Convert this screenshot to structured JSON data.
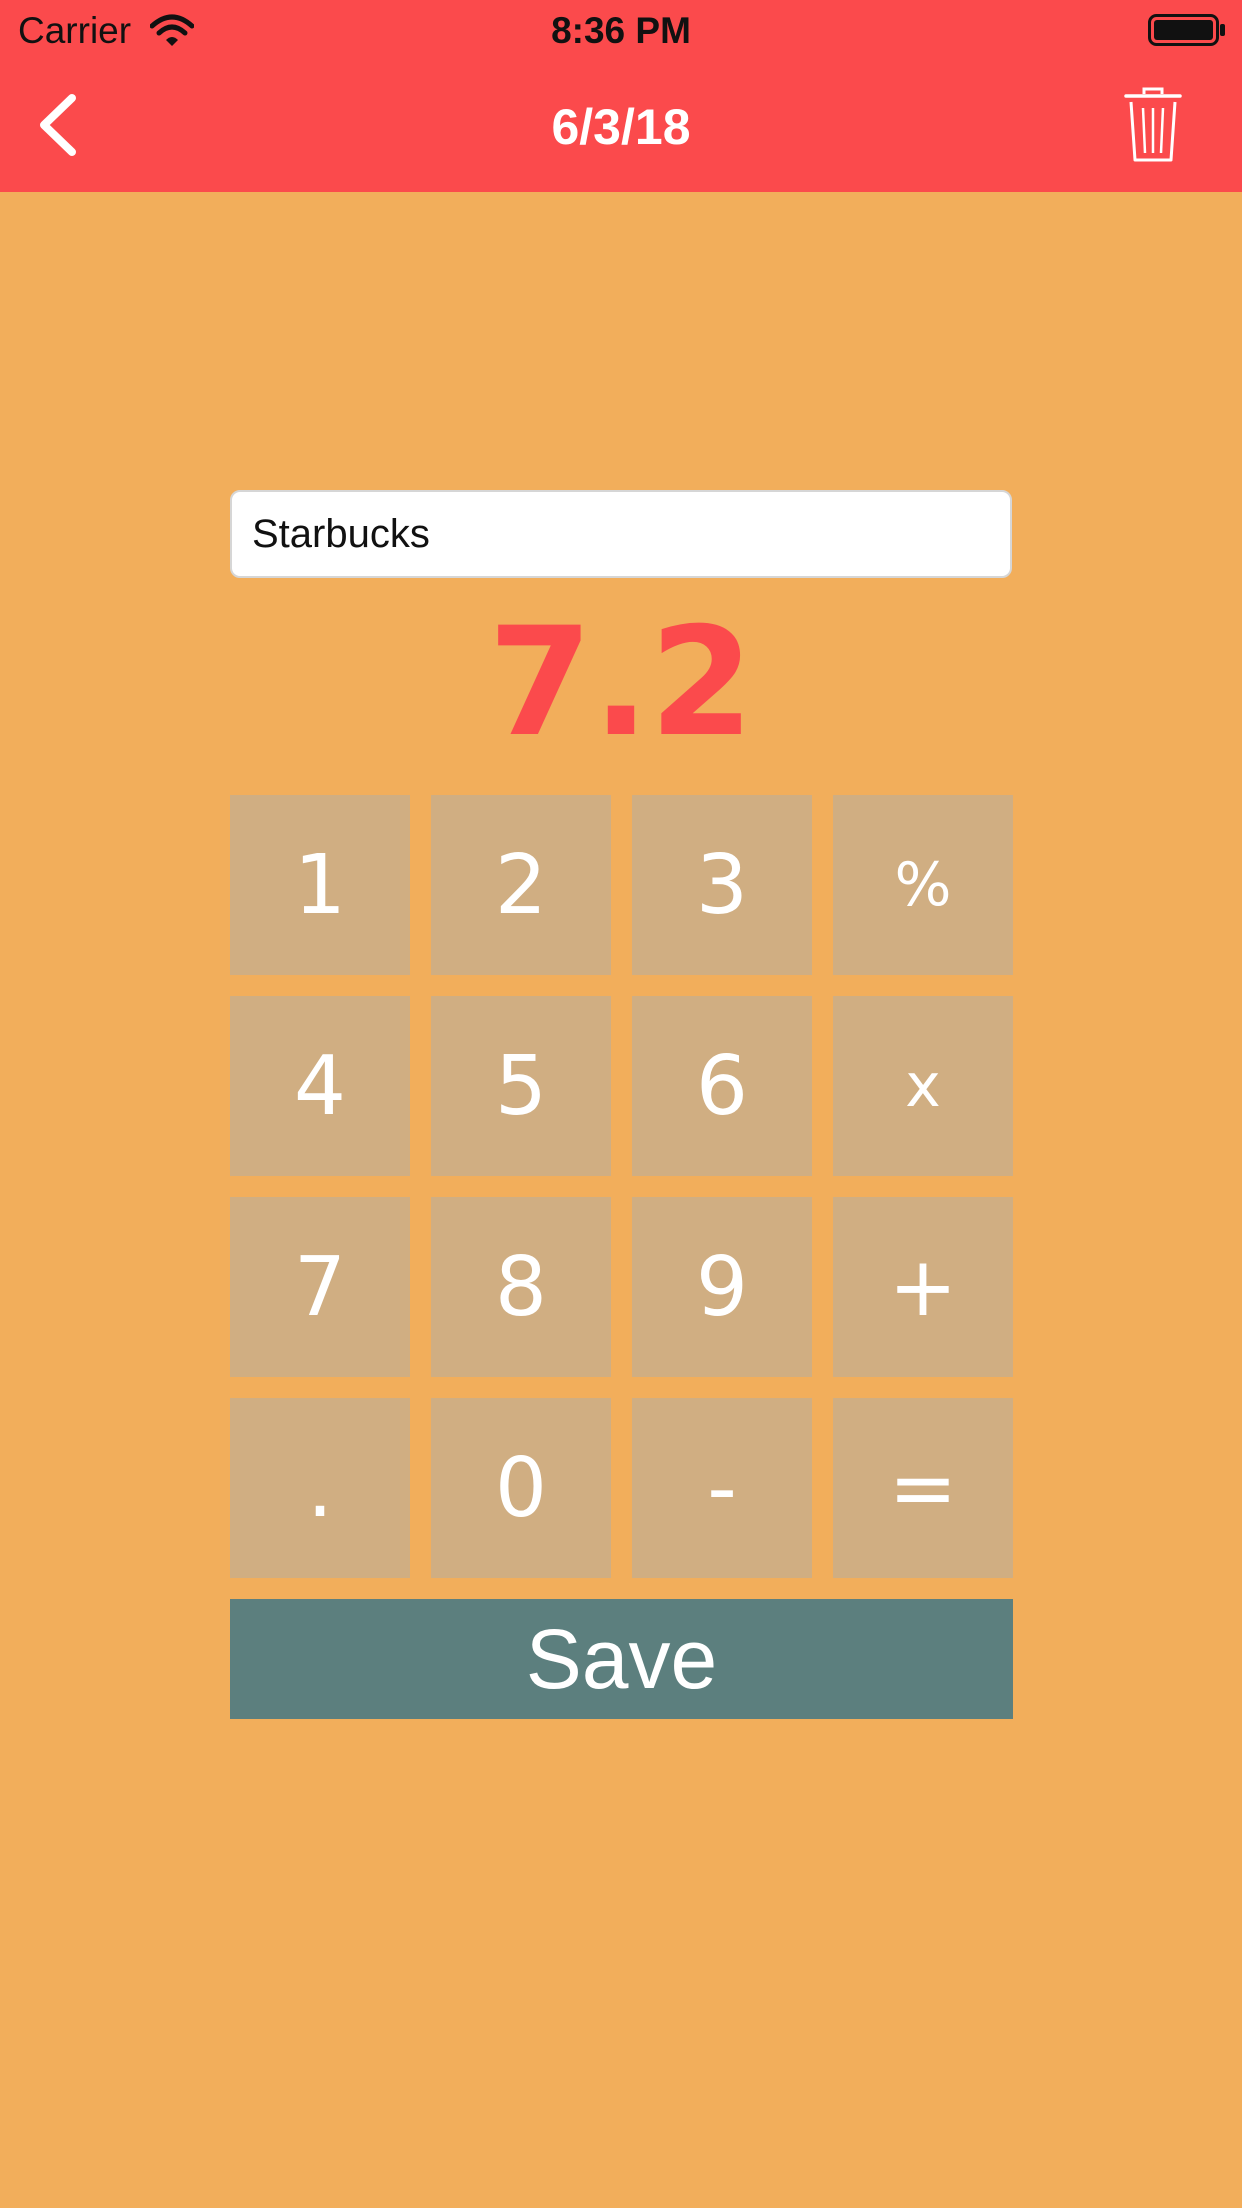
{
  "status_bar": {
    "carrier": "Carrier",
    "time": "8:36 PM",
    "icons": [
      "wifi-icon",
      "battery-icon"
    ]
  },
  "nav": {
    "title": "6/3/18",
    "back_icon": "chevron-left-icon",
    "delete_icon": "trash-icon"
  },
  "entry": {
    "name_value": "Starbucks",
    "amount": "7.2"
  },
  "keypad": {
    "keys": [
      "1",
      "2",
      "3",
      "%",
      "4",
      "5",
      "6",
      "x",
      "7",
      "8",
      "9",
      "+",
      ".",
      "0",
      "-",
      "="
    ]
  },
  "save_label": "Save",
  "colors": {
    "header": "#FB4A4C",
    "background": "#F2AE5B",
    "key": "#D0AE82",
    "save": "#5C7F7E",
    "amount": "#FB4A4C"
  }
}
